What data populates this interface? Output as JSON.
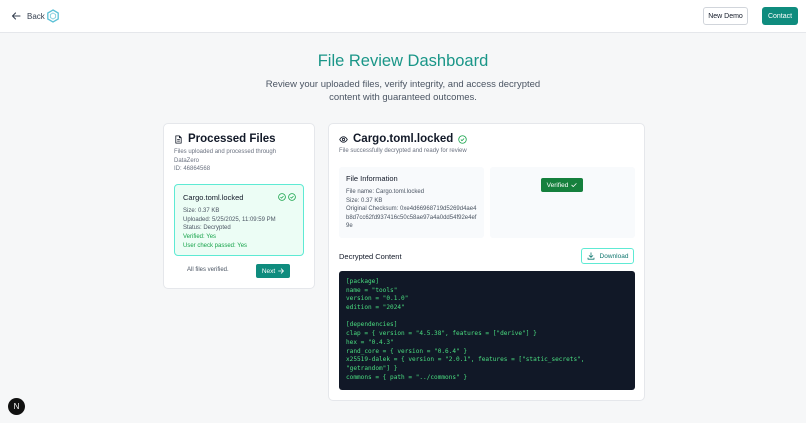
{
  "header": {
    "back_label": "Back",
    "new_demo_label": "New Demo",
    "contact_label": "Contact"
  },
  "hero": {
    "title": "File Review Dashboard",
    "subtitle": "Review your uploaded files, verify integrity, and access decrypted content with guaranteed outcomes."
  },
  "processed": {
    "title": "Processed Files",
    "description": "Files uploaded and processed through DataZero",
    "id_line": "ID: 46864568",
    "file": {
      "name": "Cargo.toml.locked",
      "size": "Size: 0.37 KB",
      "uploaded": "Uploaded: 5/25/2025, 11:09:59 PM",
      "status": "Status: Decrypted",
      "verified": "Verified: Yes",
      "user_check": "User check passed: Yes"
    },
    "footer_text": "All files verified.",
    "next_label": "Next"
  },
  "detail": {
    "title": "Cargo.toml.locked",
    "description": "File successfully decrypted and ready for review",
    "info": {
      "title": "File Information",
      "file_name": "File name: Cargo.toml.locked",
      "size": "Size: 0.37 KB",
      "checksum": "Original Checksum: 0xe4d66968719d5269d4ae4b8d7cc62fd937416c50c58ae97a4a0dd54f92e4ef9e"
    },
    "verified_label": "Verified",
    "decrypted_label": "Decrypted Content",
    "download_label": "Download",
    "code_lines": [
      "[package]",
      "name = \"tools\"",
      "version = \"0.1.0\"",
      "edition = \"2024\"",
      "",
      "[dependencies]",
      "clap = { version = \"4.5.38\", features = [\"derive\"] }",
      "hex = \"0.4.3\"",
      "rand_core = { version = \"0.6.4\" }",
      "x25519-dalek = { version = \"2.0.1\", features = [\"static_secrets\",",
      "\"getrandom\"] }",
      "commons = { path = \"../commons\" }"
    ]
  },
  "avatar_letter": "N",
  "colors": {
    "accent": "#0f8c7e",
    "title": "#1a9688",
    "success": "#15803d",
    "code_bg": "#111827",
    "code_fg": "#4ade80"
  }
}
